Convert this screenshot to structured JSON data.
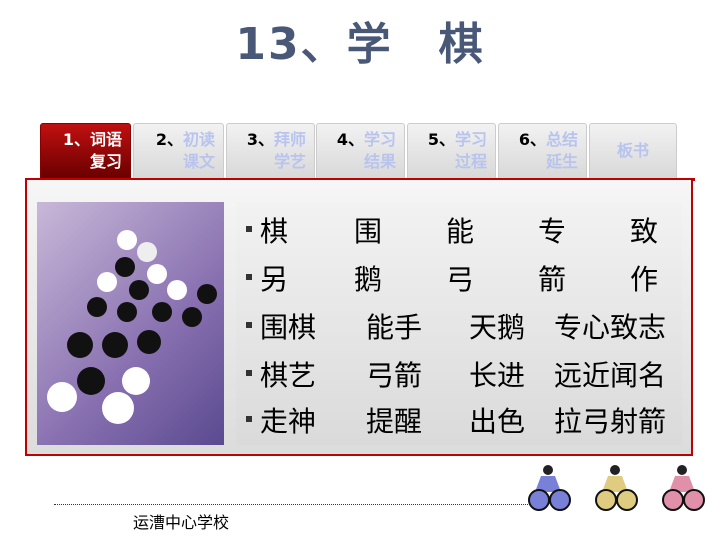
{
  "title": "13、学　棋",
  "tabs": [
    {
      "num": "1、",
      "line1": "词语",
      "line2": "复习",
      "active": true
    },
    {
      "num": "2、",
      "line1": "初读",
      "line2": "课文"
    },
    {
      "num": "3、",
      "line1": "拜师",
      "line2": "学艺"
    },
    {
      "num": "4、",
      "line1": "学习",
      "line2": "结果"
    },
    {
      "num": "5、",
      "line1": "学习",
      "line2": "过程"
    },
    {
      "num": "6、",
      "line1": "总结",
      "line2": "延生"
    },
    {
      "num": "",
      "line1": "板书",
      "line2": ""
    }
  ],
  "words": [
    [
      "棋",
      "围",
      "能",
      "专",
      "致"
    ],
    [
      "另",
      "鹅",
      "弓",
      "箭",
      "作"
    ],
    [
      "围棋",
      "能手",
      "天鹅",
      "专心致志"
    ],
    [
      "棋艺",
      "弓箭",
      "长进",
      "远近闻名"
    ],
    [
      "走神",
      "提醒",
      "出色",
      "拉弓射箭"
    ]
  ],
  "footer": {
    "school": "运漕中心学校"
  },
  "colors": {
    "accent": "#c00000",
    "title": "#4a5878",
    "tab_text": "#b8c4ee"
  }
}
